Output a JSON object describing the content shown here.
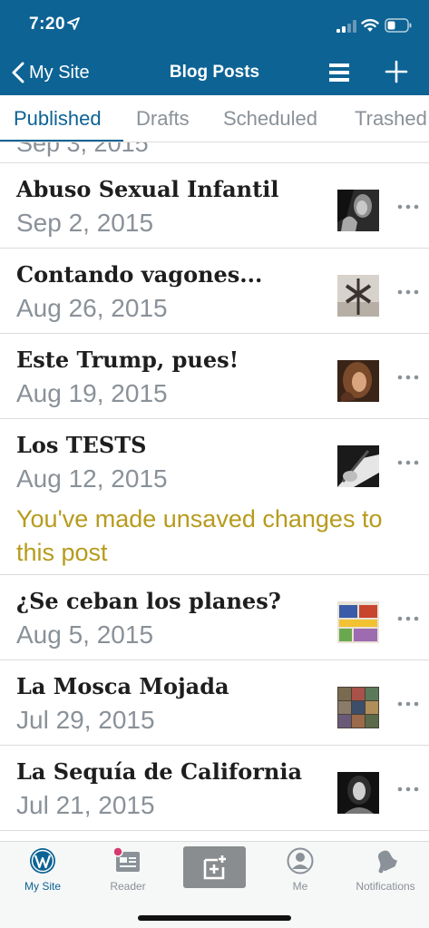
{
  "status_bar": {
    "time": "7:20"
  },
  "nav": {
    "back_label": "My Site",
    "title": "Blog Posts"
  },
  "tabs": [
    {
      "label": "Published",
      "active": true
    },
    {
      "label": "Drafts",
      "active": false
    },
    {
      "label": "Scheduled",
      "active": false
    },
    {
      "label": "Trashed",
      "active": false
    }
  ],
  "partial_row": {
    "date": "Sep 3, 2015"
  },
  "posts": [
    {
      "title": "Abuso Sexual Infantil",
      "date": "Sep 2, 2015",
      "note": ""
    },
    {
      "title": "Contando vagones...",
      "date": "Aug 26, 2015",
      "note": ""
    },
    {
      "title": "Este Trump, pues!",
      "date": "Aug 19, 2015",
      "note": ""
    },
    {
      "title": "Los TESTS",
      "date": "Aug 12, 2015",
      "note": "You've made unsaved changes to this post"
    },
    {
      "title": "¿Se ceban los planes?",
      "date": "Aug 5, 2015",
      "note": ""
    },
    {
      "title": "La Mosca Mojada",
      "date": "Jul 29, 2015",
      "note": ""
    },
    {
      "title": "La Sequía de California",
      "date": "Jul 21, 2015",
      "note": ""
    }
  ],
  "tabbar": {
    "my_site": "My Site",
    "reader": "Reader",
    "me": "Me",
    "notifications": "Notifications"
  },
  "colors": {
    "brand": "#0d6394",
    "note": "#b79b1d",
    "muted": "#8a9198",
    "badge": "#d63a6f"
  },
  "icons": [
    "location-arrow-icon",
    "signal-icon",
    "wifi-icon",
    "battery-icon",
    "chevron-left-icon",
    "list-menu-icon",
    "plus-icon",
    "more-horizontal-icon",
    "wordpress-icon",
    "reader-icon",
    "new-post-icon",
    "me-icon",
    "notifications-bell-icon"
  ]
}
